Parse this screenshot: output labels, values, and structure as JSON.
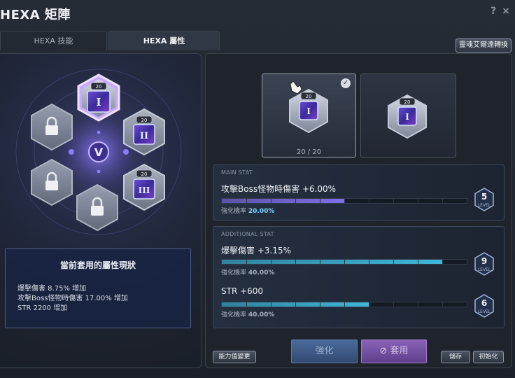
{
  "window": {
    "title": "HEXA 矩陣",
    "help": "?",
    "close": "×"
  },
  "tabs": [
    {
      "label": "HEXA 技能"
    },
    {
      "label": "HEXA 屬性"
    }
  ],
  "convert_button": "靈魂艾爾達轉換",
  "hex_nodes": [
    {
      "state": "unlocked",
      "level": "20",
      "glyph": "I"
    },
    {
      "state": "unlocked",
      "level": "20",
      "glyph": "II"
    },
    {
      "state": "unlocked",
      "level": "20",
      "glyph": "III"
    },
    {
      "state": "locked"
    },
    {
      "state": "locked"
    },
    {
      "state": "locked"
    }
  ],
  "center_emblem": "V",
  "status": {
    "title": "當前套用的屬性現狀",
    "lines": [
      "爆擊傷害 8.75% 增加",
      "攻擊Boss怪物時傷害 17.00% 增加",
      "STR 2200 增加"
    ]
  },
  "cards": [
    {
      "level": "20",
      "count": "20 / 20",
      "selected": true
    },
    {
      "level": "20",
      "selected": false
    }
  ],
  "main_stat": {
    "section": "MAIN STAT",
    "name": "攻擊Boss怪物時傷害 +6.00%",
    "rate_label": "強化機率",
    "rate": "20.00%",
    "level": "5",
    "level_word": "LEVEL",
    "progress": 0.5
  },
  "additional_stat": {
    "section": "ADDITIONAL STAT",
    "items": [
      {
        "name": "爆擊傷害 +3.15%",
        "rate_label": "強化機率",
        "rate": "40.00%",
        "level": "9",
        "level_word": "LEVEL",
        "progress": 0.9
      },
      {
        "name": "STR +600",
        "rate_label": "強化機率",
        "rate": "40.00%",
        "level": "6",
        "level_word": "LEVEL",
        "progress": 0.6
      }
    ]
  },
  "buttons": {
    "enhance": "強化",
    "apply": "套用",
    "reset_stat": "能力值變更",
    "save": "儲存",
    "init": "初始化"
  },
  "colors": {
    "main_bar": "#7e6fe6",
    "add_bar": "#3fb6d8",
    "main_rate": "#7ed7ff",
    "add_rate": "#b9c0cb"
  }
}
